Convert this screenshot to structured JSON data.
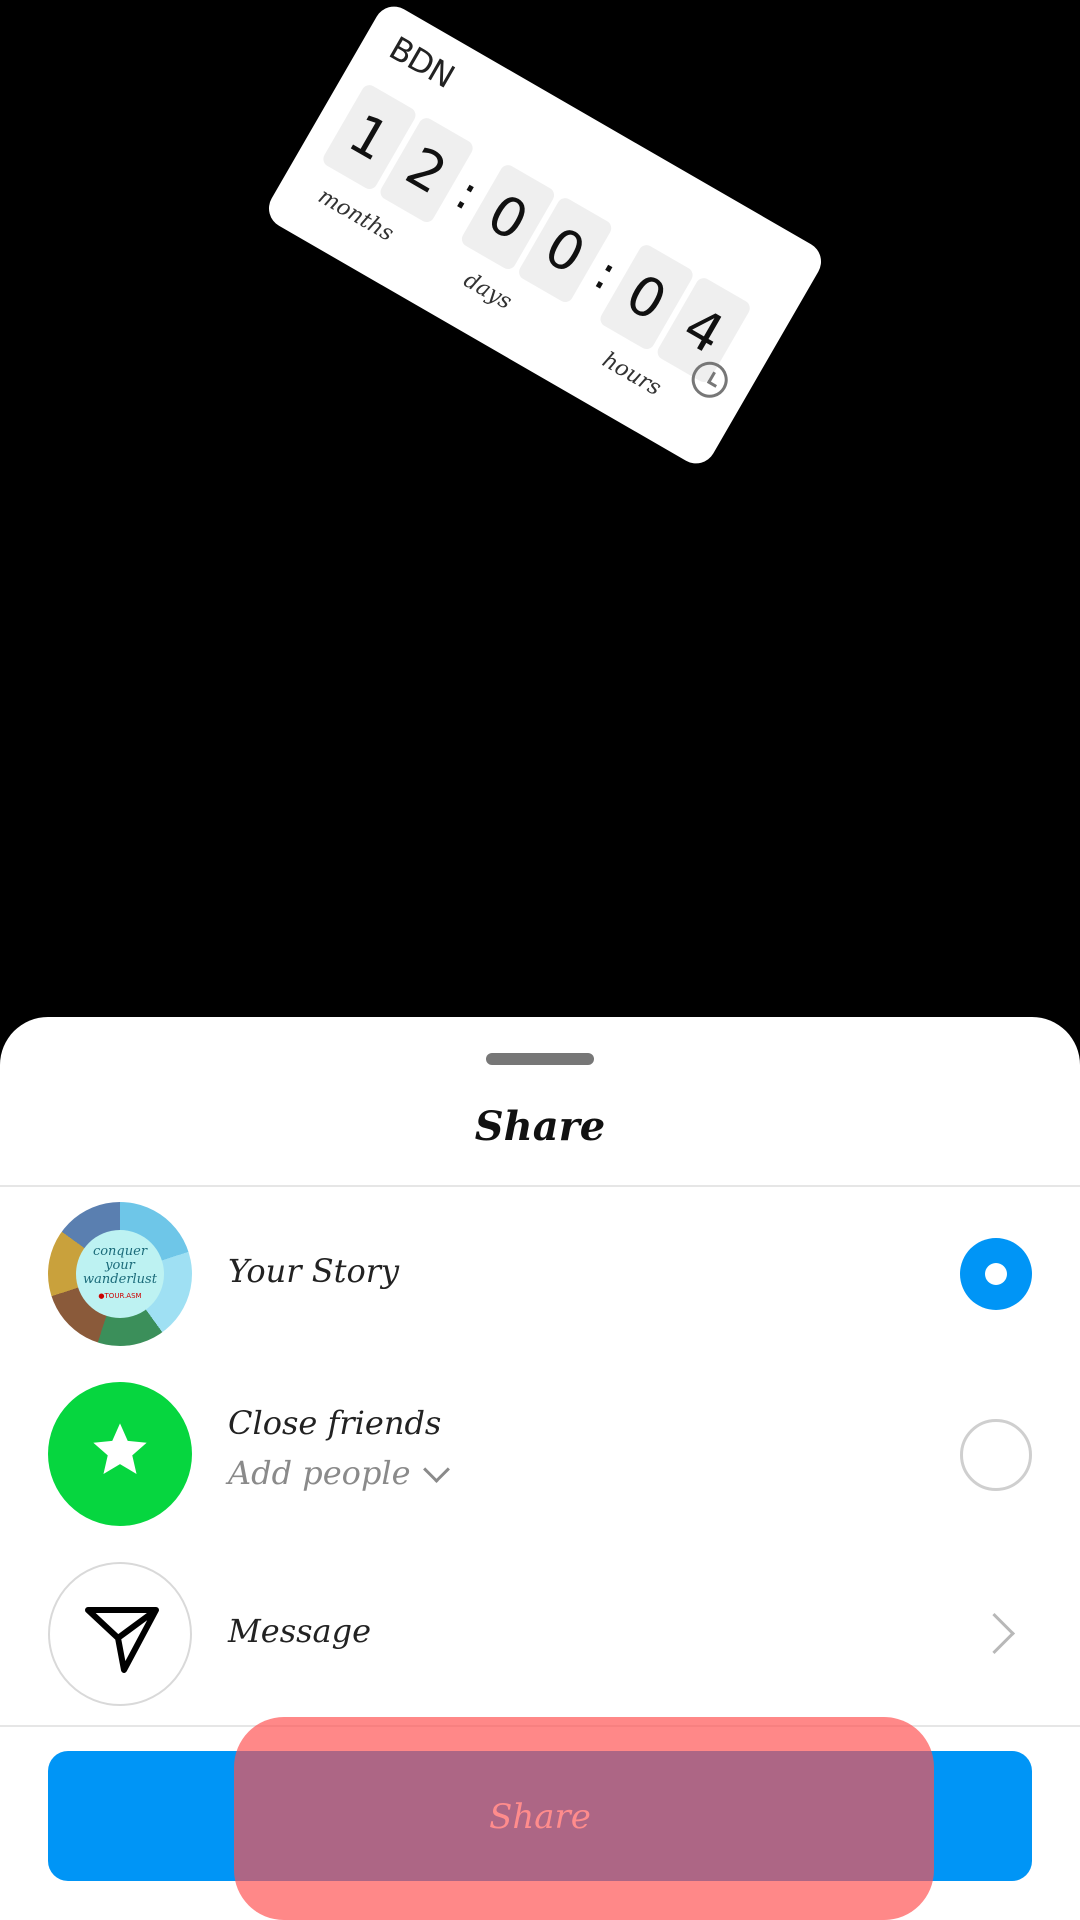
{
  "sticker": {
    "title": "BDN",
    "digits": [
      "1",
      "2",
      "0",
      "0",
      "0",
      "4"
    ],
    "separator": ":",
    "units": {
      "months": "months",
      "days": "days",
      "hours": "hours"
    },
    "icon": "clock-icon"
  },
  "sheet": {
    "title": "Share",
    "options": {
      "your_story": {
        "label": "Your Story",
        "avatar_text": [
          "conquer",
          "your",
          "wanderlust"
        ],
        "avatar_tag": "●TOUR.ASM",
        "selected": true
      },
      "close_friends": {
        "label": "Close friends",
        "sublabel": "Add people",
        "icon": "star-icon",
        "selected": false
      },
      "message": {
        "label": "Message",
        "icon": "paper-plane-icon"
      }
    },
    "share_button": {
      "label": "Share"
    }
  },
  "colors": {
    "accent": "#0095f6",
    "green": "#06d63f",
    "highlight": "#ff5050"
  }
}
